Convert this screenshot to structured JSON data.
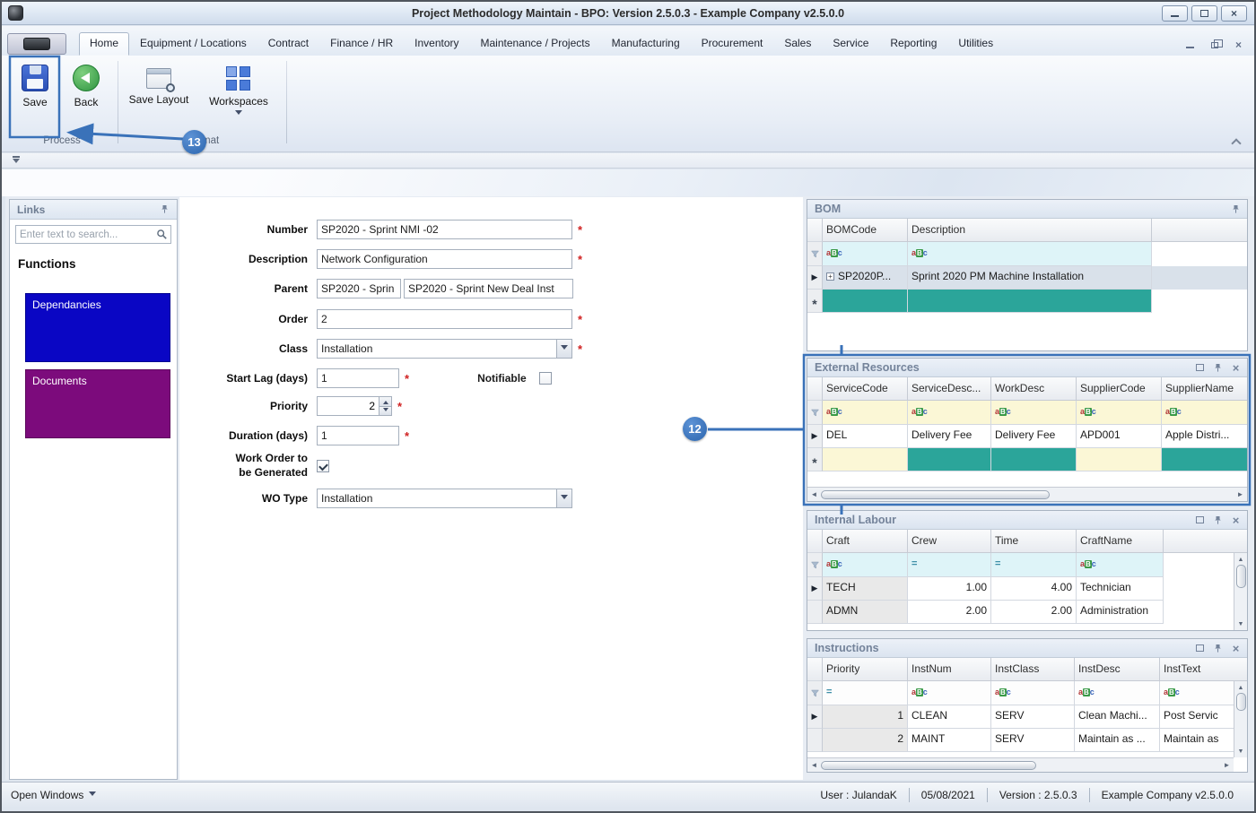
{
  "colors": {
    "accent": "#3a72b9",
    "teal": "#2ba59a",
    "dep-blue": "#0a06c4",
    "doc-purple": "#7c0b7c",
    "required": "#d02020",
    "filter-cyan": "#def4f8",
    "filter-yellow": "#fbf7d6"
  },
  "window": {
    "title": "Project Methodology Maintain - BPO: Version 2.5.0.3 - Example Company v2.5.0.0"
  },
  "ribbon": {
    "tabs": [
      "Home",
      "Equipment / Locations",
      "Contract",
      "Finance / HR",
      "Inventory",
      "Maintenance / Projects",
      "Manufacturing",
      "Procurement",
      "Sales",
      "Service",
      "Reporting",
      "Utilities"
    ],
    "buttons": {
      "save": "Save",
      "back": "Back",
      "save_layout": "Save Layout",
      "workspaces": "Workspaces"
    },
    "groups": {
      "process": "Process",
      "format": "Format"
    }
  },
  "links": {
    "title": "Links",
    "search_placeholder": "Enter text to search...",
    "heading": "Functions",
    "items": [
      "Dependancies",
      "Documents"
    ]
  },
  "form": {
    "required_marker": "*",
    "number": {
      "label": "Number",
      "value": "SP2020 - Sprint NMI -02"
    },
    "description": {
      "label": "Description",
      "value": "Network Configuration"
    },
    "parent": {
      "label": "Parent",
      "value1": "SP2020 - Sprin",
      "value2": "SP2020 - Sprint New Deal Inst"
    },
    "order": {
      "label": "Order",
      "value": "2"
    },
    "class": {
      "label": "Class",
      "value": "Installation"
    },
    "start_lag": {
      "label": "Start Lag (days)",
      "value": "1"
    },
    "notifiable": {
      "label": "Notifiable"
    },
    "priority": {
      "label": "Priority",
      "value": "2"
    },
    "duration": {
      "label": "Duration (days)",
      "value": "1"
    },
    "wo_generated": {
      "label": "Work Order to be Generated"
    },
    "wo_type": {
      "label": "WO Type",
      "value": "Installation"
    }
  },
  "panels": {
    "bom": {
      "title": "BOM",
      "columns": [
        "BOMCode",
        "Description"
      ],
      "row": [
        "SP2020P...",
        "Sprint 2020 PM Machine Installation"
      ]
    },
    "external_resources": {
      "title": "External Resources",
      "columns": [
        "ServiceCode",
        "ServiceDesc...",
        "WorkDesc",
        "SupplierCode",
        "SupplierName"
      ],
      "row": [
        "DEL",
        "Delivery Fee",
        "Delivery Fee",
        "APD001",
        "Apple Distri..."
      ]
    },
    "internal_labour": {
      "title": "Internal Labour",
      "columns": [
        "Craft",
        "Crew",
        "Time",
        "CraftName"
      ],
      "rows": [
        [
          "TECH",
          "1.00",
          "4.00",
          "Technician"
        ],
        [
          "ADMN",
          "2.00",
          "2.00",
          "Administration"
        ]
      ]
    },
    "instructions": {
      "title": "Instructions",
      "columns": [
        "Priority",
        "InstNum",
        "InstClass",
        "InstDesc",
        "InstText"
      ],
      "rows": [
        [
          "1",
          "CLEAN",
          "SERV",
          "Clean Machi...",
          "Post Servic"
        ],
        [
          "2",
          "MAINT",
          "SERV",
          "Maintain as ...",
          "Maintain as"
        ]
      ]
    }
  },
  "statusbar": {
    "open_windows": "Open Windows",
    "user": "User : JulandaK",
    "date": "05/08/2021",
    "version": "Version : 2.5.0.3",
    "company": "Example Company v2.5.0.0"
  },
  "annotations": {
    "step_save": "13",
    "step_resources": "12"
  }
}
